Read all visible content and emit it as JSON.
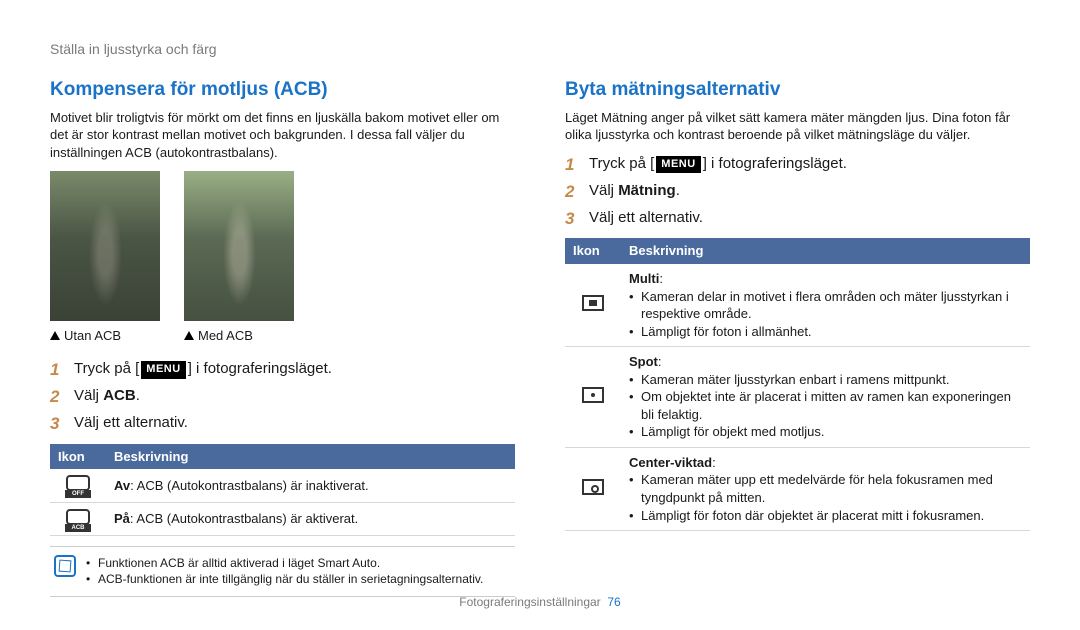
{
  "breadcrumb": "Ställa in ljusstyrka och färg",
  "left": {
    "heading": "Kompensera för motljus (ACB)",
    "intro": "Motivet blir troligtvis för mörkt om det finns en ljuskälla bakom motivet eller om det är stor kontrast mellan motivet och bakgrunden. I dessa fall väljer du inställningen ACB (autokontrastbalans).",
    "caption_without": "Utan ACB",
    "caption_with": "Med ACB",
    "step1_a": "Tryck på [",
    "menu_label": "MENU",
    "step1_b": "] i fotograferingsläget.",
    "step2_a": "Välj ",
    "step2_b": "ACB",
    "step2_c": ".",
    "step3": "Välj ett alternativ.",
    "th_icon": "Ikon",
    "th_desc": "Beskrivning",
    "row_off_b": "Av",
    "row_off_t": ": ACB (Autokontrastbalans) är inaktiverat.",
    "row_on_b": "På",
    "row_on_t": ": ACB (Autokontrastbalans) är aktiverat.",
    "note1": "Funktionen ACB är alltid aktiverad i läget Smart Auto.",
    "note2": "ACB-funktionen är inte tillgänglig när du ställer in serietagningsalternativ."
  },
  "right": {
    "heading": "Byta mätningsalternativ",
    "intro": "Läget Mätning anger på vilket sätt kamera mäter mängden ljus. Dina foton får olika ljusstyrka och kontrast beroende på vilket mätningsläge du väljer.",
    "step1_a": "Tryck på [",
    "step1_b": "] i fotograferingsläget.",
    "step2_a": "Välj ",
    "step2_b": "Mätning",
    "step2_c": ".",
    "step3": "Välj ett alternativ.",
    "th_icon": "Ikon",
    "th_desc": "Beskrivning",
    "multi_t": "Multi",
    "multi_b1": "Kameran delar in motivet i flera områden och mäter ljusstyrkan i respektive område.",
    "multi_b2": "Lämpligt för foton i allmänhet.",
    "spot_t": "Spot",
    "spot_b1": "Kameran mäter ljusstyrkan enbart i ramens mittpunkt.",
    "spot_b2": "Om objektet inte är placerat i mitten av ramen kan exponeringen bli felaktig.",
    "spot_b3": "Lämpligt för objekt med motljus.",
    "center_t": "Center-viktad",
    "center_b1": "Kameran mäter upp ett medelvärde för hela fokusramen med tyngdpunkt på mitten.",
    "center_b2": "Lämpligt för foton där objektet är placerat mitt i fokusramen."
  },
  "footer_label": "Fotograferingsinställningar",
  "footer_page": "76"
}
